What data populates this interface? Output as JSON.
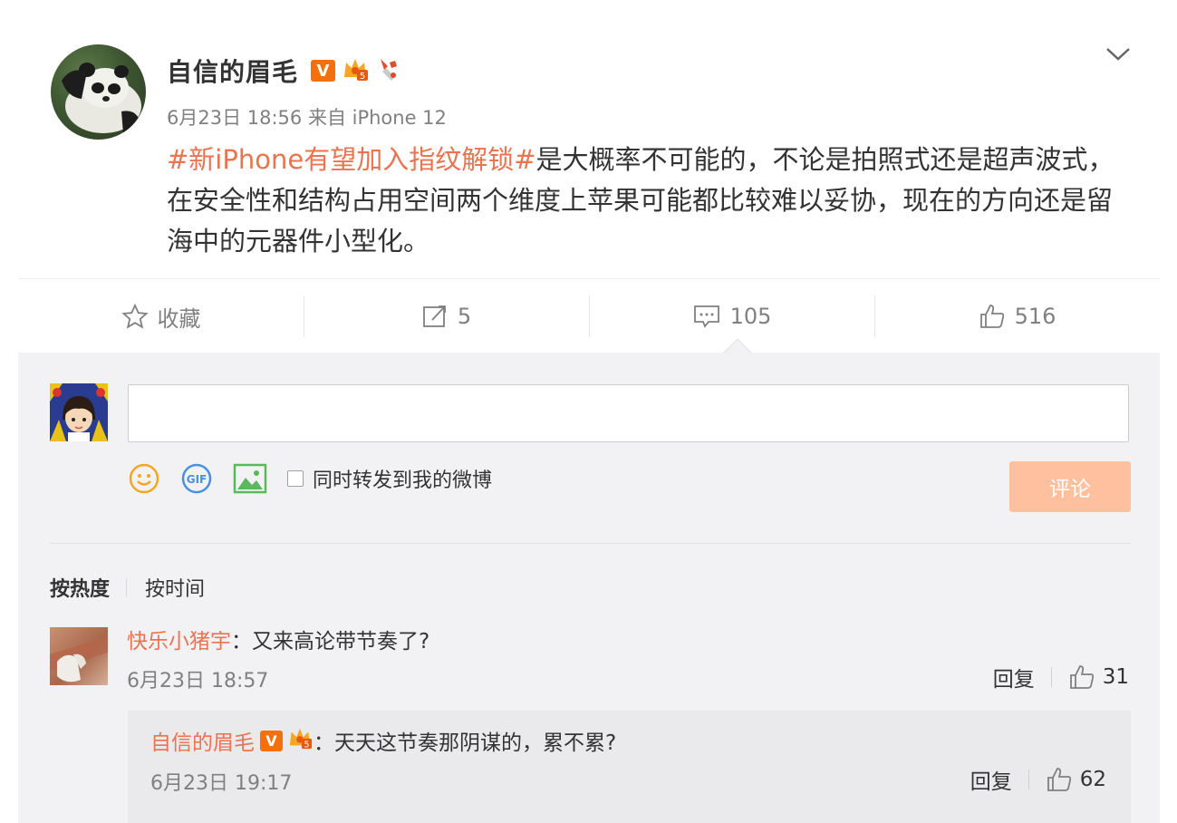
{
  "post": {
    "author": "自信的眉毛",
    "verified_badge": "V",
    "meta": "6月23日 18:56 来自 iPhone 12",
    "topic": "#新iPhone有望加入指纹解锁#",
    "text": "是大概率不可能的，不论是拍照式还是超声波式，在安全性和结构占用空间两个维度上苹果可能都比较难以妥协，现在的方向还是留海中的元器件小型化。",
    "more_icon": "chevron-down-icon"
  },
  "actions": {
    "favorite": "收藏",
    "repost_count": "5",
    "comment_count": "105",
    "like_count": "516"
  },
  "composer": {
    "sync_label": "同时转发到我的微博",
    "submit_label": "评论",
    "tools": [
      "smile-icon",
      "gif-icon",
      "image-icon"
    ]
  },
  "sort": {
    "hot": "按热度",
    "time": "按时间"
  },
  "comments": [
    {
      "user": "快乐小猪宇",
      "text": "：又来高论带节奏了?",
      "time": "6月23日 18:57",
      "reply_label": "回复",
      "likes": "31",
      "replies": [
        {
          "user": "自信的眉毛",
          "verified_badge": "V",
          "text": "：天天这节奏那阴谋的，累不累?",
          "time": "6月23日 19:17",
          "reply_label": "回复",
          "likes": "62"
        }
      ]
    }
  ],
  "colors": {
    "accent": "#eb7350",
    "verified": "#f5700a",
    "submit_disabled": "#ffc09f",
    "comment_bg": "#f2f2f5"
  }
}
